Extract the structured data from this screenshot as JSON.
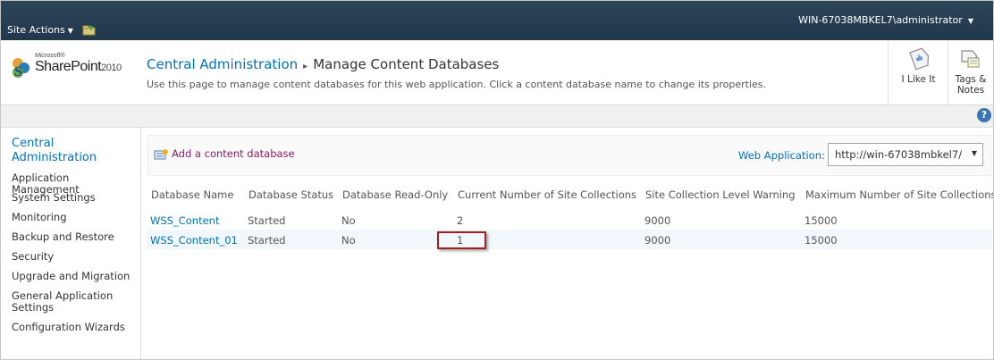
{
  "ribbon": {
    "site_actions": "Site Actions",
    "user": "WIN-67038MBKEL7\\administrator"
  },
  "logo": {
    "microsoft": "Microsoft®",
    "sharepoint": "SharePoint",
    "year": "2010"
  },
  "breadcrumb": {
    "root": "Central Administration",
    "separator": "▸",
    "current": "Manage Content Databases"
  },
  "page_description": "Use this page to manage content databases for this web application. Click a content database name to change its properties.",
  "social": {
    "like": "I Like It",
    "tags_line1": "Tags &",
    "tags_line2": "Notes"
  },
  "help_icon": "?",
  "left_nav": {
    "heading_line1": "Central",
    "heading_line2": "Administration",
    "items": [
      "Application Management",
      "System Settings",
      "Monitoring",
      "Backup and Restore",
      "Security",
      "Upgrade and Migration",
      "General Application",
      "Settings",
      "Configuration Wizards"
    ]
  },
  "toolbar": {
    "add_link": "Add a content database",
    "webapp_label": "Web Application:",
    "webapp_value": "http://win-67038mbkel7/"
  },
  "table": {
    "headers": [
      "Database Name",
      "Database Status",
      "Database Read-Only",
      "Current Number of Site Collections",
      "Site Collection Level Warning",
      "Maximum Number of Site Collections"
    ],
    "rows": [
      [
        "WSS_Content",
        "Started",
        "No",
        "2",
        "9000",
        "15000"
      ],
      [
        "WSS_Content_01",
        "Started",
        "No",
        "1",
        "9000",
        "15000"
      ]
    ]
  },
  "colors": {
    "ribbon": "#21374c",
    "link": "#0072bc",
    "add_link": "#7f1b63",
    "highlight_border": "#a51e1e"
  }
}
